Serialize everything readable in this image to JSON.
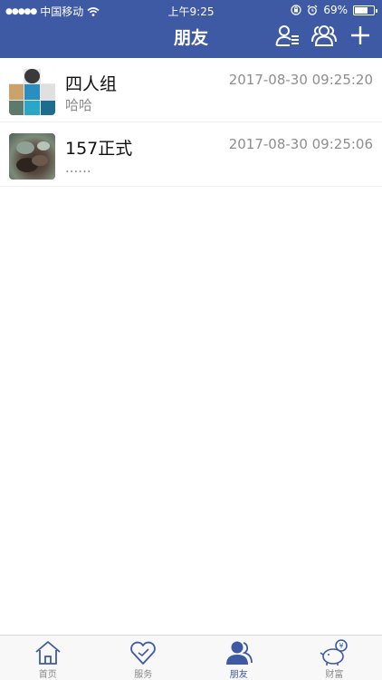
{
  "status_bar": {
    "carrier": "中国移动",
    "time": "上午9:25",
    "battery_percent": "69%",
    "battery_level": 0.69
  },
  "header": {
    "title": "朋友",
    "actions": [
      "contacts-list-icon",
      "group-icon",
      "add-icon"
    ]
  },
  "conversations": [
    {
      "name": "四人组",
      "preview": "哈哈",
      "timestamp": "2017-08-30  09:25:20"
    },
    {
      "name": "157正式",
      "preview": "......",
      "timestamp": "2017-08-30  09:25:06"
    }
  ],
  "tabs": [
    {
      "label": "首页",
      "icon": "home-icon",
      "active": false
    },
    {
      "label": "服务",
      "icon": "heart-icon",
      "active": false
    },
    {
      "label": "朋友",
      "icon": "friends-icon",
      "active": true
    },
    {
      "label": "财富",
      "icon": "piggy-bank-icon",
      "active": false
    }
  ],
  "colors": {
    "accent": "#3f5aa5",
    "tab_inactive": "#888888",
    "timestamp": "#8e8e8e"
  }
}
